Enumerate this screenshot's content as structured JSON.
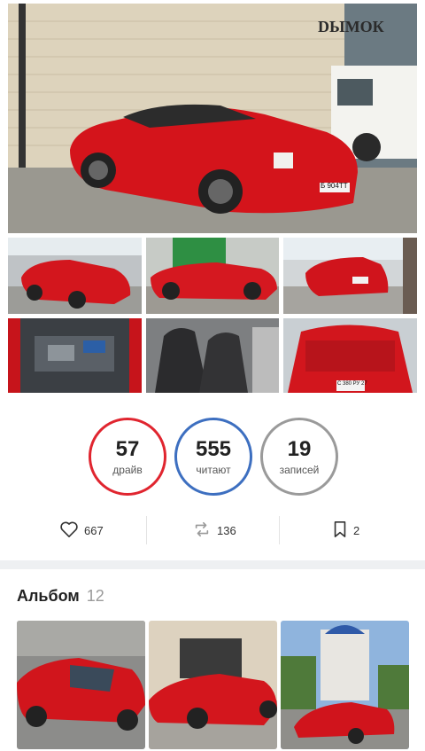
{
  "gallery": {
    "hero": {
      "alt": "red-sports-car-hero-photo",
      "plate": "Б 904ТТ",
      "sign": "DЫМОК"
    },
    "thumbs": [
      {
        "alt": "red-car-roof-off-photo"
      },
      {
        "alt": "red-car-side-photo"
      },
      {
        "alt": "red-car-rear-photo"
      },
      {
        "alt": "engine-bay-photo"
      },
      {
        "alt": "interior-seats-photo"
      },
      {
        "alt": "trunk-photo",
        "plate": "С 380 РУ 27"
      }
    ]
  },
  "stats": {
    "circles": [
      {
        "value": "57",
        "label": "драйв",
        "color": "#e0252f"
      },
      {
        "value": "555",
        "label": "читают",
        "color": "#3d6fc0"
      },
      {
        "value": "19",
        "label": "записей",
        "color": "#9a9a9a"
      }
    ],
    "actions": {
      "likes": "667",
      "reposts": "136",
      "bookmarks": "2"
    }
  },
  "album": {
    "title": "Альбом",
    "count": "12",
    "photos": [
      {
        "alt": "album-photo-convertible"
      },
      {
        "alt": "album-photo-garage"
      },
      {
        "alt": "album-photo-church"
      }
    ]
  }
}
